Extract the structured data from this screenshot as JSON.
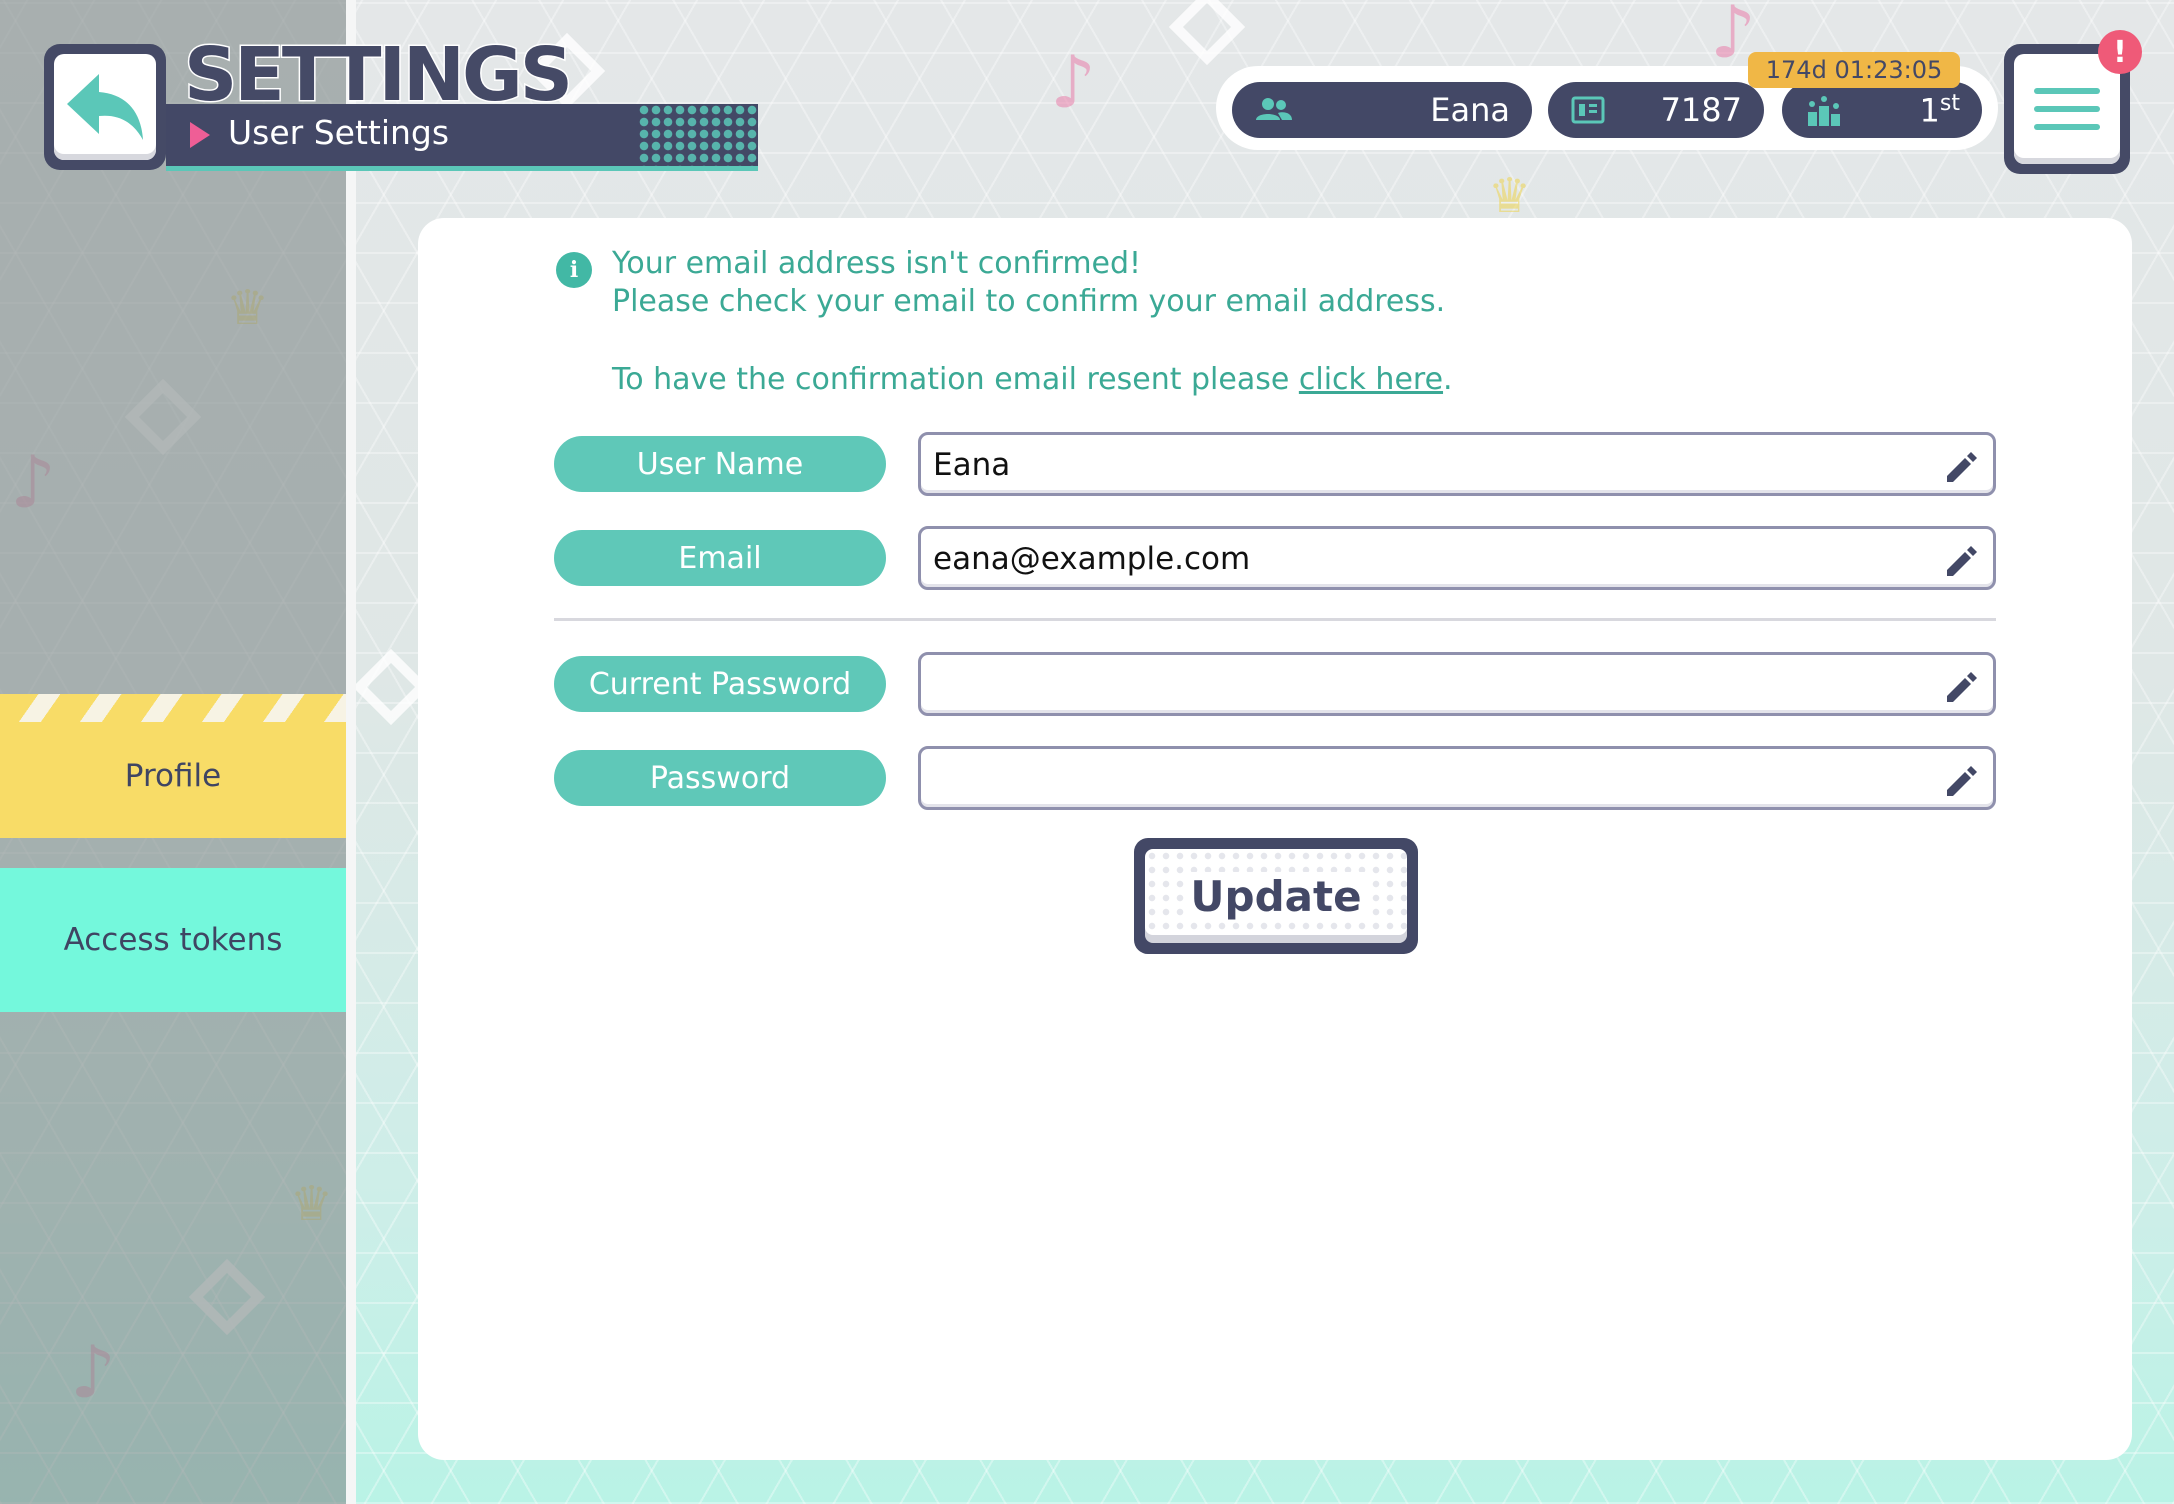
{
  "header": {
    "title": "SETTINGS",
    "subtitle": "User Settings"
  },
  "status": {
    "user_name": "Eana",
    "points": "7187",
    "rank_number": "1",
    "rank_suffix": "st",
    "timer": "174d 01:23:05",
    "alert": "!"
  },
  "sidebar": {
    "items": [
      {
        "label": "Profile"
      },
      {
        "label": "Access tokens"
      }
    ]
  },
  "notice": {
    "line1": "Your email address isn't confirmed!",
    "line2": "Please check your email to confirm your email address.",
    "line3_prefix": "To have the confirmation email resent please ",
    "line3_link": "click here",
    "line3_suffix": "."
  },
  "form": {
    "fields": [
      {
        "label": "User Name",
        "value": "Eana"
      },
      {
        "label": "Email",
        "value": "eana@example.com"
      },
      {
        "label": "Current Password",
        "value": ""
      },
      {
        "label": "Password",
        "value": ""
      }
    ],
    "submit_label": "Update"
  },
  "colors": {
    "accent_teal": "#5fc8b8",
    "navy": "#434866",
    "profile_yellow": "#f8dc67",
    "tokens_mint": "#74f8dc",
    "alert_pink": "#ef5a78",
    "timer_orange": "#f0b746"
  },
  "icons": {
    "back": "back-arrow-icon",
    "menu": "hamburger-menu-icon",
    "user": "users-icon",
    "points": "points-card-icon",
    "rank": "ranking-icon",
    "info": "info-icon",
    "edit": "pencil-icon"
  }
}
